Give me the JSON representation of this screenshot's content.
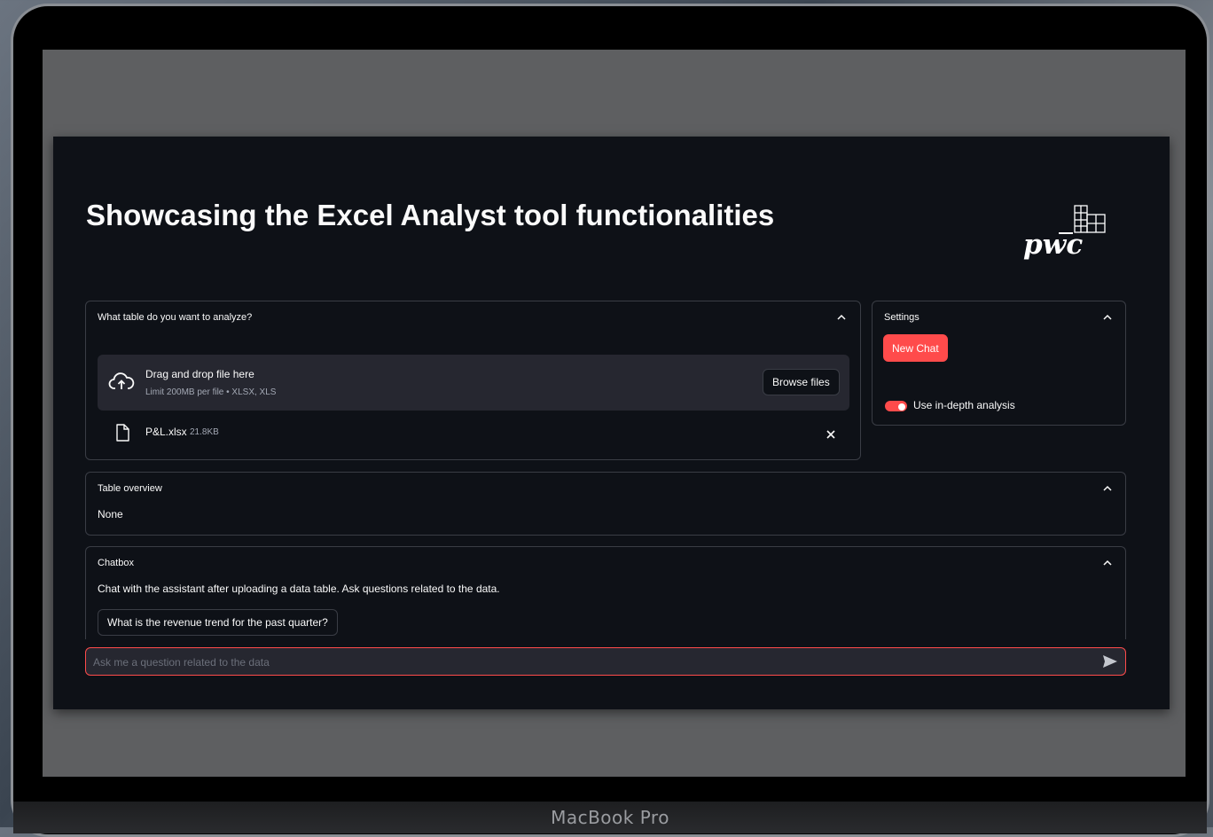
{
  "device": {
    "label": "MacBook Pro"
  },
  "page": {
    "title": "Showcasing the Excel Analyst tool functionalities"
  },
  "logo": {
    "text": "pwc"
  },
  "upload_panel": {
    "title": "What table do you want to analyze?",
    "dropzone_title": "Drag and drop file here",
    "dropzone_limit": "Limit 200MB per file • XLSX, XLS",
    "browse_label": "Browse files",
    "file": {
      "name": "P&L.xlsx",
      "size": "21.8KB"
    }
  },
  "settings_panel": {
    "title": "Settings",
    "new_chat_label": "New Chat",
    "toggle_label": "Use in-depth analysis",
    "toggle_on": true
  },
  "overview_panel": {
    "title": "Table overview",
    "value": "None"
  },
  "chatbox_panel": {
    "title": "Chatbox",
    "description": "Chat with the assistant after uploading a data table. Ask questions related to the data.",
    "suggestion": "What is the revenue trend for the past quarter?"
  },
  "chat_input": {
    "placeholder": "Ask me a question related to the data",
    "value": ""
  },
  "colors": {
    "accent": "#ff4b4b",
    "background": "#0e1117",
    "surface": "#262730",
    "text": "#fafafa"
  },
  "icons": {
    "upload": "cloud-upload-icon",
    "file": "file-icon",
    "remove": "close-icon",
    "collapse": "chevron-up-icon",
    "send": "send-icon"
  }
}
